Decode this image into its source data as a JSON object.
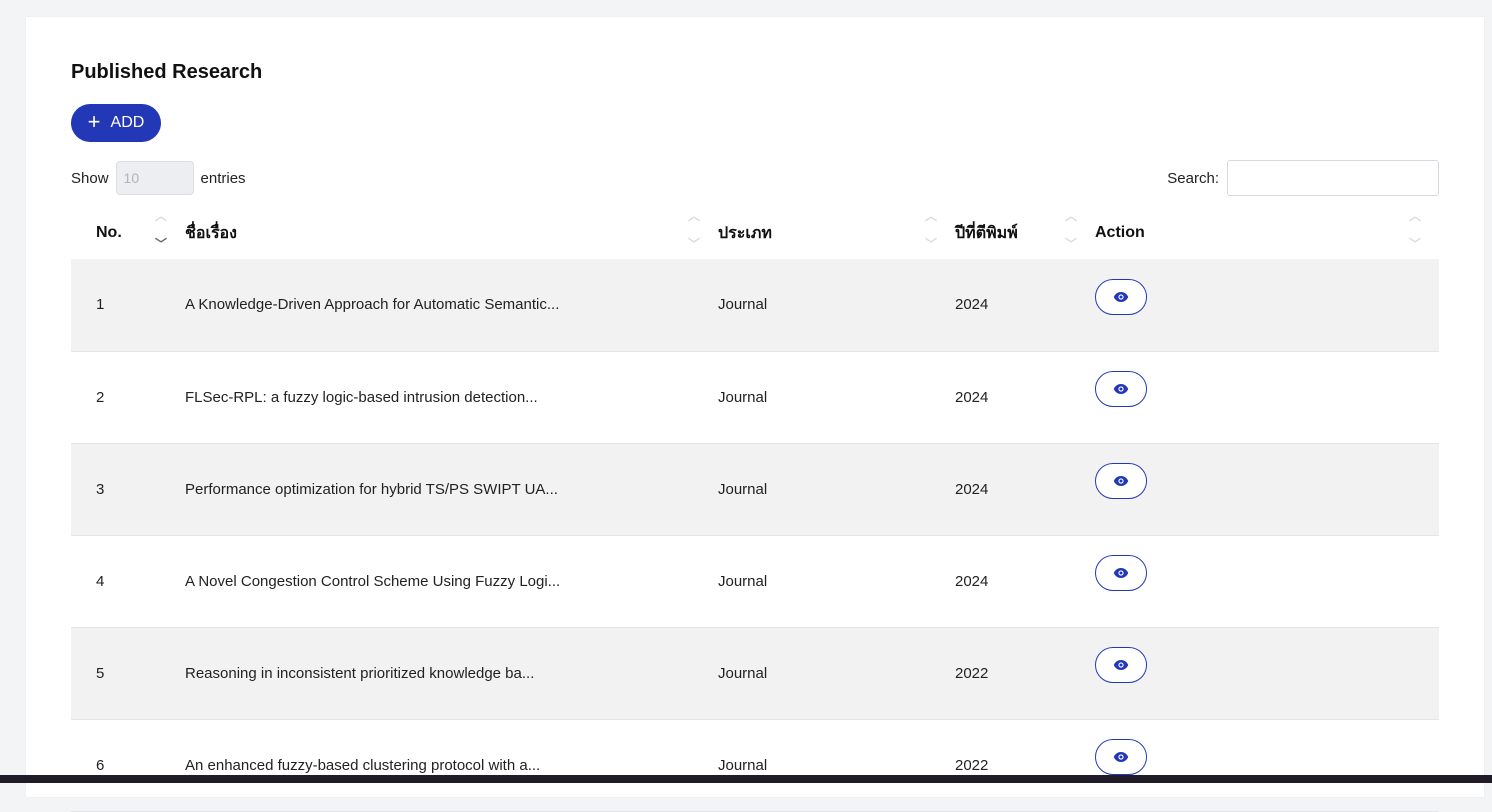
{
  "page": {
    "title": "Published Research",
    "add_label": "ADD",
    "show_label": "Show",
    "entries_value": "10",
    "entries_label": "entries",
    "search_label": "Search:"
  },
  "table": {
    "headers": [
      "No.",
      "ชื่อเรื่อง",
      "ประเภท",
      "ปีที่ตีพิมพ์",
      "Action"
    ],
    "rows": [
      {
        "no": "1",
        "title": "A Knowledge-Driven Approach for Automatic Semantic...",
        "type": "Journal",
        "year": "2024"
      },
      {
        "no": "2",
        "title": "FLSec-RPL: a fuzzy logic-based intrusion detection...",
        "type": "Journal",
        "year": "2024"
      },
      {
        "no": "3",
        "title": "Performance optimization for hybrid TS/PS SWIPT UA...",
        "type": "Journal",
        "year": "2024"
      },
      {
        "no": "4",
        "title": "A Novel Congestion Control Scheme Using Fuzzy Logi...",
        "type": "Journal",
        "year": "2024"
      },
      {
        "no": "5",
        "title": "Reasoning in inconsistent prioritized knowledge ba...",
        "type": "Journal",
        "year": "2022"
      },
      {
        "no": "6",
        "title": "An enhanced fuzzy-based clustering protocol with a...",
        "type": "Journal",
        "year": "2022"
      }
    ]
  },
  "colors": {
    "accent": "#2338b6",
    "row_stripe": "#f2f2f2"
  },
  "icons": {
    "add": "plus-icon",
    "view": "eye-icon",
    "sort": "sort-arrows-icon"
  }
}
